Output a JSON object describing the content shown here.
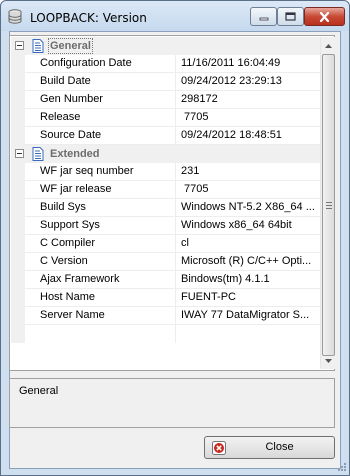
{
  "window": {
    "title": "LOOPBACK: Version"
  },
  "properties": {
    "categories": [
      {
        "label": "General",
        "expanded": true,
        "selected": true,
        "rows": [
          {
            "name": "Configuration Date",
            "value": "11/16/2011 16:04:49"
          },
          {
            "name": "Build Date",
            "value": "09/24/2012 23:29:13"
          },
          {
            "name": "Gen Number",
            "value": "298172"
          },
          {
            "name": "Release",
            "value": " 7705"
          },
          {
            "name": "Source Date",
            "value": "09/24/2012 18:48:51"
          }
        ]
      },
      {
        "label": "Extended",
        "expanded": true,
        "selected": false,
        "rows": [
          {
            "name": "WF jar seq number",
            "value": "231"
          },
          {
            "name": "WF jar release",
            "value": " 7705"
          },
          {
            "name": "Build Sys",
            "value": "Windows NT-5.2 X86_64 ..."
          },
          {
            "name": "Support Sys",
            "value": "Windows x86_64 64bit"
          },
          {
            "name": "C Compiler",
            "value": "cl"
          },
          {
            "name": "C Version",
            "value": "Microsoft (R) C/C++ Opti..."
          },
          {
            "name": "Ajax Framework",
            "value": "Bindows(tm) 4.1.1"
          },
          {
            "name": "Host Name",
            "value": "FUENT-PC"
          },
          {
            "name": "Server Name",
            "value": "IWAY 77 DataMigrator S..."
          }
        ]
      }
    ]
  },
  "description": {
    "text": "General"
  },
  "buttons": {
    "close_label": "Close"
  },
  "colors": {
    "titlebar": "#c6d9ee",
    "client_background": "#f0f0f0",
    "category_text": "#6d6d6d",
    "close_icon_red": "#c8281e"
  },
  "icons": {
    "app": "database-icon",
    "category": "document-icon",
    "close_button": "close-circle-icon"
  }
}
